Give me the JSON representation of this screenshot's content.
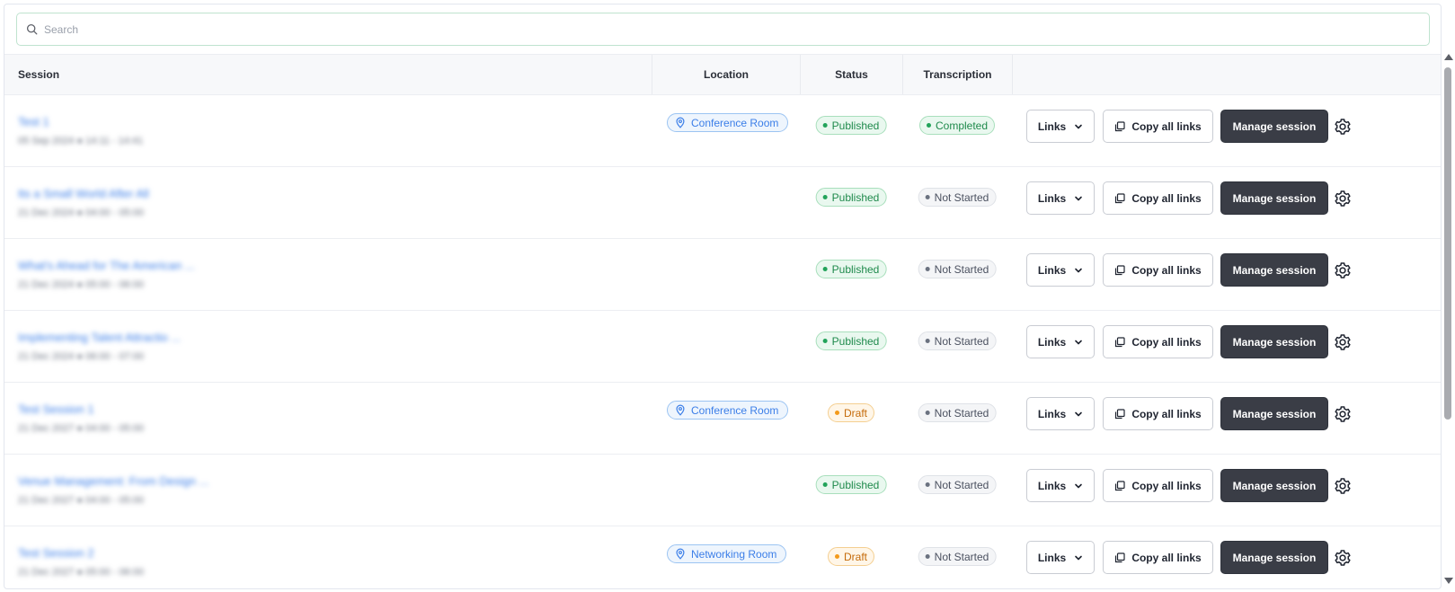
{
  "search": {
    "placeholder": "Search"
  },
  "table": {
    "headers": {
      "session": "Session",
      "location": "Location",
      "status": "Status",
      "transcription": "Transcription"
    },
    "actions": {
      "links_label": "Links",
      "copy_label": "Copy all links",
      "manage_label": "Manage session"
    },
    "rows": [
      {
        "title": "Test 1",
        "date": "05 Sep 2024 ● 14:11 - 14:41",
        "location": "Conference Room",
        "status": "Published",
        "status_kind": "published",
        "transcription": "Completed",
        "transcription_kind": "completed"
      },
      {
        "title": "Its a Small World After All",
        "date": "21 Dec 2024 ● 04:00 - 05:00",
        "location": "",
        "status": "Published",
        "status_kind": "published",
        "transcription": "Not Started",
        "transcription_kind": "notstarted"
      },
      {
        "title": "What's Ahead for The American ...",
        "date": "21 Dec 2024 ● 05:00 - 06:00",
        "location": "",
        "status": "Published",
        "status_kind": "published",
        "transcription": "Not Started",
        "transcription_kind": "notstarted"
      },
      {
        "title": "Implementing Talent Attractio ...",
        "date": "21 Dec 2024 ● 06:00 - 07:00",
        "location": "",
        "status": "Published",
        "status_kind": "published",
        "transcription": "Not Started",
        "transcription_kind": "notstarted"
      },
      {
        "title": "Test Session 1",
        "date": "21 Dec 2027 ● 04:00 - 05:00",
        "location": "Conference Room",
        "status": "Draft",
        "status_kind": "draft",
        "transcription": "Not Started",
        "transcription_kind": "notstarted"
      },
      {
        "title": "Venue Management: From Design ...",
        "date": "21 Dec 2027 ● 04:00 - 05:00",
        "location": "",
        "status": "Published",
        "status_kind": "published",
        "transcription": "Not Started",
        "transcription_kind": "notstarted"
      },
      {
        "title": "Test Session 2",
        "date": "21 Dec 2027 ● 05:00 - 06:00",
        "location": "Networking Room",
        "status": "Draft",
        "status_kind": "draft",
        "transcription": "Not Started",
        "transcription_kind": "notstarted"
      }
    ]
  },
  "icons": {
    "search": "search-icon",
    "location": "map-pin-icon",
    "chevron": "chevron-down-icon",
    "copy": "copy-icon",
    "settings": "gear-icon"
  },
  "colors": {
    "link": "#3b7ee8",
    "published": "#22a35a",
    "draft": "#f39a1b",
    "not_started": "#6b7280",
    "manage_button": "#3a3d46",
    "search_border": "#bfe3cf"
  }
}
